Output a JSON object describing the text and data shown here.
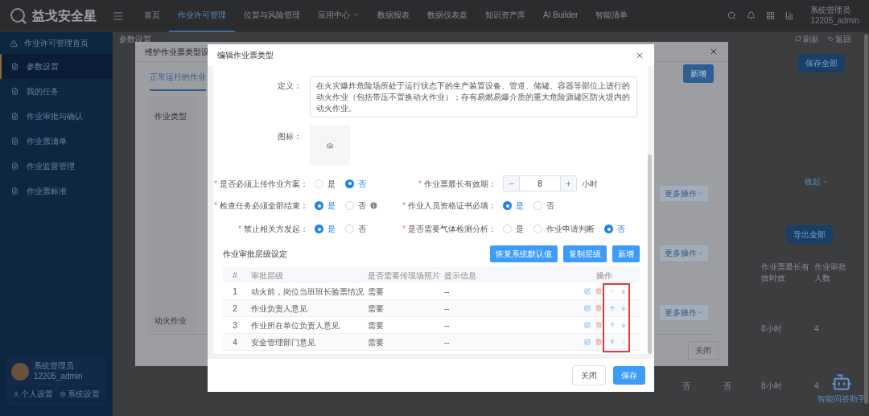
{
  "nav": {
    "logo": "益戈安全星",
    "items": [
      {
        "label": "首页",
        "selected": false,
        "dropdown": false
      },
      {
        "label": "作业许可管理",
        "selected": true,
        "dropdown": false
      },
      {
        "label": "位置与风险管理",
        "selected": false,
        "dropdown": false
      },
      {
        "label": "应用中心",
        "selected": false,
        "dropdown": true
      },
      {
        "label": "数据报表",
        "selected": false,
        "dropdown": false
      },
      {
        "label": "数据仪表盘",
        "selected": false,
        "dropdown": false
      },
      {
        "label": "知识资产库",
        "selected": false,
        "dropdown": false
      },
      {
        "label": "AI Builder",
        "selected": false,
        "dropdown": false
      },
      {
        "label": "智能清单",
        "selected": false,
        "dropdown": false
      }
    ],
    "user": {
      "name": "系统管理员",
      "id": "12205_admin"
    }
  },
  "sidebar": {
    "header": "作业许可管理首页",
    "items": [
      {
        "label": "参数设置",
        "selected": true
      },
      {
        "label": "我的任务",
        "selected": false
      },
      {
        "label": "作业审批与确认",
        "selected": false
      },
      {
        "label": "作业票清单",
        "selected": false
      },
      {
        "label": "作业监督管理",
        "selected": false
      },
      {
        "label": "作业票标准",
        "selected": false
      }
    ],
    "user": {
      "name": "系统管理员",
      "id": "12205_admin",
      "buttons": [
        "个人设置",
        "系统设置"
      ]
    }
  },
  "page": {
    "breadcrumb": "参数设置",
    "refresh": "刷新",
    "back": "返回",
    "save_all": "保存全部",
    "collapse": "收起",
    "export_all": "导出全部",
    "headers": [
      "作业票最长有效时效",
      "作业审批人数"
    ],
    "upper_cells": [
      "8小时",
      "4"
    ],
    "lower_cells": [
      "否",
      "否",
      "8小时",
      "4"
    ],
    "assistant": "智能问答助手"
  },
  "type_dialog": {
    "title": "维护作业票类型设",
    "tab": "正常运行的作业",
    "add": "新增",
    "column": "作业类型",
    "cell": "动火作业",
    "more": [
      "更多操作",
      "更多操作",
      "更多操作"
    ],
    "close": "关闭"
  },
  "edit_dialog": {
    "title": "编辑作业票类型",
    "definition": {
      "label": "定义：",
      "value": "在火灾爆炸危险场所处于运行状态下的生产装置设备、管道、储罐、容器等部位上进行的动火作业（包括带压不置换动火作业）；存有易燃易爆介质的重大危险源罐区防火堤内的动火作业。"
    },
    "icon_label": "图标：",
    "rows": [
      [
        {
          "kind": "radio",
          "mark": "*",
          "label": "是否必须上传作业方案：",
          "hint": false,
          "options": [
            {
              "label": "是",
              "selected": false
            },
            {
              "label": "否",
              "selected": true
            }
          ]
        },
        {
          "kind": "stepper",
          "mark": "*",
          "label": "作业票最长有效期：",
          "value": "8",
          "unit": "小时"
        }
      ],
      [
        {
          "kind": "radio",
          "mark": "*",
          "label": "检查任务必须全部结束：",
          "hint": true,
          "options": [
            {
              "label": "是",
              "selected": true
            },
            {
              "label": "否",
              "selected": false
            }
          ]
        },
        {
          "kind": "radio",
          "mark": "*",
          "label": "作业人员资格证书必填：",
          "hint": false,
          "options": [
            {
              "label": "是",
              "selected": true
            },
            {
              "label": "否",
              "selected": false
            }
          ]
        }
      ],
      [
        {
          "kind": "radio",
          "mark": "*",
          "label": "禁止相关方发起：",
          "hint": false,
          "options": [
            {
              "label": "是",
              "selected": true
            },
            {
              "label": "否",
              "selected": false
            }
          ]
        },
        {
          "kind": "radio",
          "mark": "*",
          "label": "是否需要气体检测分析：",
          "hint": false,
          "options": [
            {
              "label": "是",
              "selected": false
            },
            {
              "label": "作业申请判断",
              "selected": false
            },
            {
              "label": "否",
              "selected": true
            }
          ]
        }
      ]
    ],
    "approval": {
      "title": "作业审批层级设定",
      "buttons": [
        "恢复系统默认值",
        "复制层级",
        "新增"
      ],
      "columns": [
        "#",
        "审批层级",
        "是否需要传现场照片",
        "提示信息",
        "操作"
      ],
      "rows": [
        {
          "index": "1",
          "level": "动火前，岗位当班班长验票情况",
          "photo": "需要",
          "hint": "--",
          "can_up": false,
          "can_down": true
        },
        {
          "index": "2",
          "level": "作业负责人意见",
          "photo": "需要",
          "hint": "--",
          "can_up": true,
          "can_down": true
        },
        {
          "index": "3",
          "level": "作业所在单位负责人意见",
          "photo": "需要",
          "hint": "--",
          "can_up": true,
          "can_down": true
        },
        {
          "index": "4",
          "level": "安全管理部门意见",
          "photo": "需要",
          "hint": "--",
          "can_up": true,
          "can_down": false
        }
      ]
    },
    "footer": [
      "关闭",
      "保存"
    ]
  }
}
